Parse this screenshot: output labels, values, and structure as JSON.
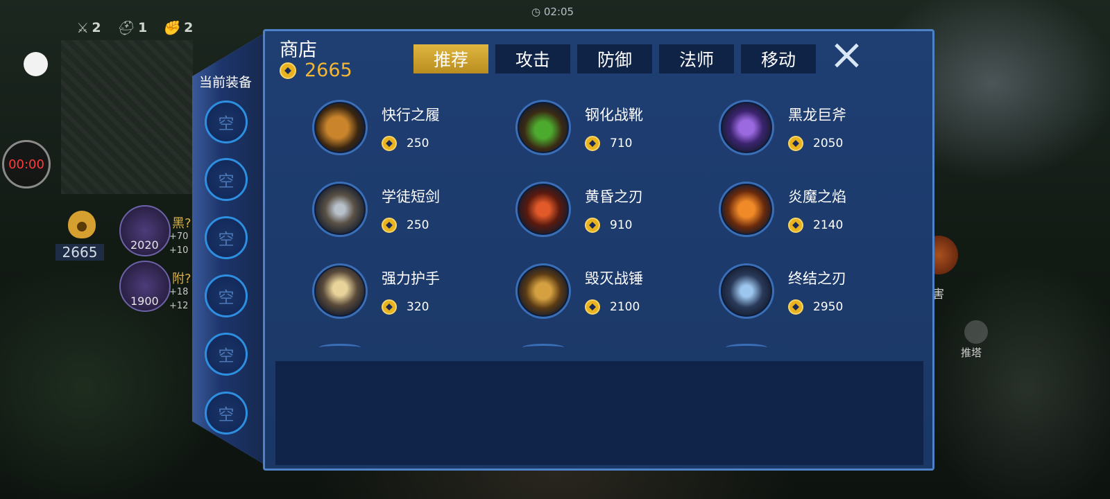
{
  "hud": {
    "stats": [
      {
        "icon": "sword-icon",
        "glyph": "⚔",
        "value": "2"
      },
      {
        "icon": "helmet-icon",
        "glyph": "⛑",
        "value": "1"
      },
      {
        "icon": "fist-icon",
        "glyph": "✊",
        "value": "2"
      }
    ],
    "top_timer": "02:05",
    "record_timer": "00:00",
    "gold": "2665",
    "recommended": [
      {
        "price": "2020",
        "name": "黑?",
        "sub1": "+70",
        "sub2": "+10"
      },
      {
        "price": "1900",
        "name": "附?",
        "sub1": "+18",
        "sub2": "+12"
      }
    ],
    "push_tower": "推塔",
    "side_label": "害"
  },
  "equipment": {
    "title": "当前装备",
    "slots": [
      "空",
      "空",
      "空",
      "空",
      "空",
      "空"
    ]
  },
  "shop": {
    "title": "商店",
    "gold": "2665",
    "tabs": [
      {
        "label": "推荐",
        "active": true
      },
      {
        "label": "攻击",
        "active": false
      },
      {
        "label": "防御",
        "active": false
      },
      {
        "label": "法师",
        "active": false
      },
      {
        "label": "移动",
        "active": false
      }
    ],
    "items": [
      {
        "name": "快行之履",
        "price": "250",
        "icon": "boots-icon",
        "color": "#b8731f"
      },
      {
        "name": "钢化战靴",
        "price": "710",
        "icon": "green-boots-icon",
        "color": "#4caa2e"
      },
      {
        "name": "黑龙巨斧",
        "price": "2050",
        "icon": "axe-icon",
        "color": "#7a45c8"
      },
      {
        "name": "学徒短剑",
        "price": "250",
        "icon": "short-sword-icon",
        "color": "#9aa3ad"
      },
      {
        "name": "黄昏之刃",
        "price": "910",
        "icon": "twilight-blade-icon",
        "color": "#d2452a"
      },
      {
        "name": "炎魔之焰",
        "price": "2140",
        "icon": "flame-icon",
        "color": "#e0741f"
      },
      {
        "name": "强力护手",
        "price": "320",
        "icon": "gauntlet-icon",
        "color": "#d7b048"
      },
      {
        "name": "毁灭战锤",
        "price": "2100",
        "icon": "hammer-icon",
        "color": "#c28a2c"
      },
      {
        "name": "终结之刃",
        "price": "2950",
        "icon": "blade-icon",
        "color": "#6ea4d8"
      }
    ]
  }
}
